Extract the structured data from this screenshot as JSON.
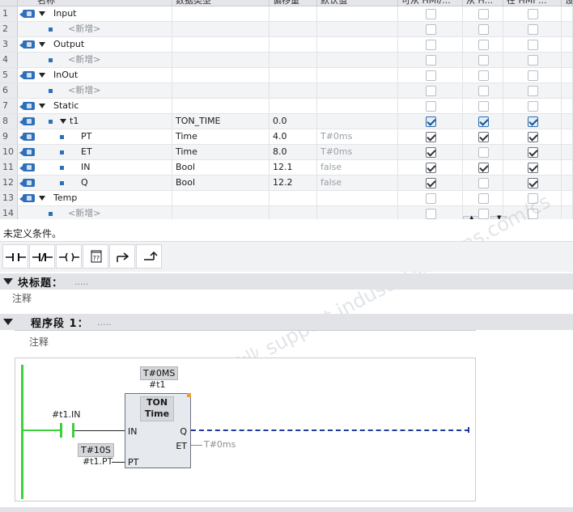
{
  "table": {
    "headers": [
      "名称",
      "数据类型",
      "偏移量",
      "默认值",
      "可从 HMI/...",
      "从 H...",
      "在 HMI ...",
      "设"
    ],
    "rows": [
      {
        "num": "1",
        "level": 0,
        "icon": true,
        "expand": true,
        "name": "Input",
        "type": "",
        "offset": "",
        "default": "",
        "hmi": [
          "off",
          "off",
          "off"
        ]
      },
      {
        "num": "2",
        "level": 1,
        "icon": false,
        "expand": false,
        "name": "<新增>",
        "new": true,
        "type": "",
        "offset": "",
        "default": "",
        "hmi": [
          "off",
          "off",
          "off"
        ]
      },
      {
        "num": "3",
        "level": 0,
        "icon": true,
        "expand": true,
        "name": "Output",
        "type": "",
        "offset": "",
        "default": "",
        "hmi": [
          "off",
          "off",
          "off"
        ]
      },
      {
        "num": "4",
        "level": 1,
        "icon": false,
        "expand": false,
        "name": "<新增>",
        "new": true,
        "type": "",
        "offset": "",
        "default": "",
        "hmi": [
          "off",
          "off",
          "off"
        ]
      },
      {
        "num": "5",
        "level": 0,
        "icon": true,
        "expand": true,
        "name": "InOut",
        "type": "",
        "offset": "",
        "default": "",
        "hmi": [
          "off",
          "off",
          "off"
        ]
      },
      {
        "num": "6",
        "level": 1,
        "icon": false,
        "expand": false,
        "name": "<新增>",
        "new": true,
        "type": "",
        "offset": "",
        "default": "",
        "hmi": [
          "off",
          "off",
          "off"
        ]
      },
      {
        "num": "7",
        "level": 0,
        "icon": true,
        "expand": true,
        "name": "Static",
        "type": "",
        "offset": "",
        "default": "",
        "hmi": [
          "off",
          "off",
          "off"
        ]
      },
      {
        "num": "8",
        "level": 1,
        "icon": true,
        "expand": true,
        "name": "t1",
        "type": "TON_TIME",
        "offset": "0.0",
        "default": "",
        "hmi": [
          "blue",
          "blue",
          "blue"
        ]
      },
      {
        "num": "9",
        "level": 2,
        "icon": true,
        "expand": false,
        "name": "PT",
        "type": "Time",
        "offset": "4.0",
        "default": "T#0ms",
        "hmi": [
          "on",
          "on",
          "on"
        ]
      },
      {
        "num": "10",
        "level": 2,
        "icon": true,
        "expand": false,
        "name": "ET",
        "type": "Time",
        "offset": "8.0",
        "default": "T#0ms",
        "hmi": [
          "on",
          "off",
          "on"
        ]
      },
      {
        "num": "11",
        "level": 2,
        "icon": true,
        "expand": false,
        "name": "IN",
        "type": "Bool",
        "offset": "12.1",
        "default": "false",
        "hmi": [
          "on",
          "on",
          "on"
        ]
      },
      {
        "num": "12",
        "level": 2,
        "icon": true,
        "expand": false,
        "name": "Q",
        "type": "Bool",
        "offset": "12.2",
        "default": "false",
        "hmi": [
          "on",
          "off",
          "on"
        ]
      },
      {
        "num": "13",
        "level": 0,
        "icon": true,
        "expand": true,
        "name": "Temp",
        "type": "",
        "offset": "",
        "default": "",
        "hmi": [
          "off",
          "off",
          "off"
        ]
      },
      {
        "num": "14",
        "level": 1,
        "icon": false,
        "expand": false,
        "name": "<新增>",
        "new": true,
        "type": "",
        "offset": "",
        "default": "",
        "hmi": [
          "off",
          "off",
          "off"
        ]
      }
    ]
  },
  "watermark": "西门子工业 support.industry.siemens.com/cs",
  "condition_text": "未定义条件。",
  "toolbar": {
    "buttons": [
      "no-contact-icon",
      "nc-contact-icon",
      "coil-icon",
      "empty-box-icon",
      "open-branch-icon",
      "close-branch-icon"
    ],
    "box_label": "??"
  },
  "block": {
    "title_label": "块标题：",
    "title_value": ".....",
    "comment": "注释"
  },
  "network": {
    "title_label": "程序段 1：",
    "title_value": ".....",
    "comment": "注释",
    "instance_constant": "T#0MS",
    "instance_name": "#t1",
    "block_type": "TON",
    "block_subtype": "Time",
    "in_var": "#t1.IN",
    "pin_in": "IN",
    "pin_q": "Q",
    "pin_et": "ET",
    "pin_pt": "PT",
    "pt_constant": "T#10S",
    "pt_var": "#t1.PT",
    "et_value": "T#0ms"
  },
  "colors": {
    "power_flow": "#3ad13a",
    "dashed_output": "#1e3aa0",
    "interface_icon": "#2f6fb8"
  }
}
